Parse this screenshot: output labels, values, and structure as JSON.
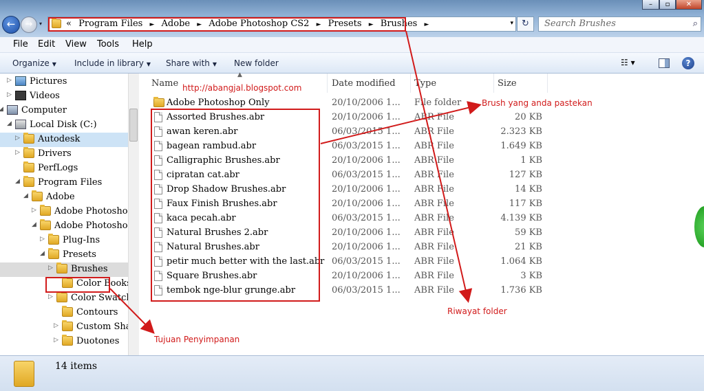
{
  "window": {
    "minimize_glyph": "–",
    "maximize_glyph": "▫",
    "close_glyph": "✕"
  },
  "nav_buttons": {
    "back_glyph": "←",
    "forward_glyph": "→",
    "recent_glyph": "▾"
  },
  "address": {
    "overflow": "«",
    "crumbs": [
      "Program Files",
      "Adobe",
      "Adobe Photoshop CS2",
      "Presets",
      "Brushes"
    ],
    "separator": "►",
    "dropdown_glyph": "▾",
    "refresh_glyph": "↻"
  },
  "search": {
    "placeholder": "Search Brushes",
    "icon": "⌕"
  },
  "menu": [
    "File",
    "Edit",
    "View",
    "Tools",
    "Help"
  ],
  "commands": {
    "organize": "Organize",
    "include": "Include in library",
    "share": "Share with",
    "new_folder": "New folder",
    "view_glyph": "☷ ▾",
    "help_glyph": "?"
  },
  "nav": [
    {
      "label": "Pictures",
      "tri": "▷"
    },
    {
      "label": "Videos",
      "tri": "▷"
    },
    {
      "label": "Computer",
      "tri": "◢"
    },
    {
      "label": "Local Disk (C:)",
      "tri": "◢"
    },
    {
      "label": "Autodesk",
      "tri": "▷"
    },
    {
      "label": "Drivers",
      "tri": "▷"
    },
    {
      "label": "PerfLogs",
      "tri": ""
    },
    {
      "label": "Program Files",
      "tri": "◢"
    },
    {
      "label": "Adobe",
      "tri": "◢"
    },
    {
      "label": "Adobe Photosho",
      "tri": "▷"
    },
    {
      "label": "Adobe Photosho",
      "tri": "◢"
    },
    {
      "label": "Plug-Ins",
      "tri": "▷"
    },
    {
      "label": "Presets",
      "tri": "◢"
    },
    {
      "label": "Brushes",
      "tri": "▷"
    },
    {
      "label": "Color Books",
      "tri": ""
    },
    {
      "label": "Color Swatch",
      "tri": "▷"
    },
    {
      "label": "Contours",
      "tri": ""
    },
    {
      "label": "Custom Shap",
      "tri": "▷"
    },
    {
      "label": "Duotones",
      "tri": "▷"
    }
  ],
  "columns": {
    "name": "Name",
    "date": "Date modified",
    "type": "Type",
    "size": "Size",
    "sort_glyph": "▲"
  },
  "watermark": "http://abangjal.blogspot.com",
  "files": [
    {
      "name": "Adobe Photoshop Only",
      "date": "20/10/2006 1...",
      "type": "File folder",
      "size": "",
      "folder": true
    },
    {
      "name": "Assorted Brushes.abr",
      "date": "20/10/2006 1...",
      "type": "ABR File",
      "size": "20 KB"
    },
    {
      "name": "awan keren.abr",
      "date": "06/03/2015 1...",
      "type": "ABR File",
      "size": "2.323 KB"
    },
    {
      "name": "bagean rambud.abr",
      "date": "06/03/2015 1...",
      "type": "ABR File",
      "size": "1.649 KB"
    },
    {
      "name": "Calligraphic Brushes.abr",
      "date": "20/10/2006 1...",
      "type": "ABR File",
      "size": "1 KB"
    },
    {
      "name": "cipratan cat.abr",
      "date": "06/03/2015 1...",
      "type": "ABR File",
      "size": "127 KB"
    },
    {
      "name": "Drop Shadow Brushes.abr",
      "date": "20/10/2006 1...",
      "type": "ABR File",
      "size": "14 KB"
    },
    {
      "name": "Faux Finish Brushes.abr",
      "date": "20/10/2006 1...",
      "type": "ABR File",
      "size": "117 KB"
    },
    {
      "name": "kaca pecah.abr",
      "date": "06/03/2015 1...",
      "type": "ABR File",
      "size": "4.139 KB"
    },
    {
      "name": "Natural Brushes 2.abr",
      "date": "20/10/2006 1...",
      "type": "ABR File",
      "size": "59 KB"
    },
    {
      "name": "Natural Brushes.abr",
      "date": "20/10/2006 1...",
      "type": "ABR File",
      "size": "21 KB"
    },
    {
      "name": "petir much better with the last.abr",
      "date": "06/03/2015 1...",
      "type": "ABR File",
      "size": "1.064 KB"
    },
    {
      "name": "Square Brushes.abr",
      "date": "20/10/2006 1...",
      "type": "ABR File",
      "size": "3 KB"
    },
    {
      "name": "tembok nge-blur grunge.abr",
      "date": "06/03/2015 1...",
      "type": "ABR File",
      "size": "1.736 KB"
    }
  ],
  "status": {
    "count": "14 items"
  },
  "annotations": {
    "brush_note": "Brush yang anda pastekan",
    "history_note": "Riwayat folder",
    "target_note": "Tujuan Penyimpanan",
    "color": "#d11a1a"
  }
}
